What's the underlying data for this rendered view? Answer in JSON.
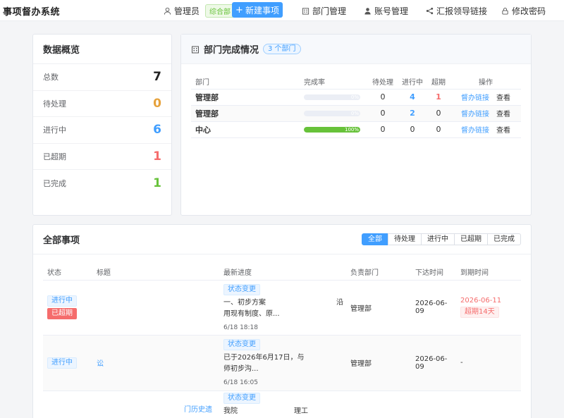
{
  "header": {
    "brand": "事项督办系统",
    "user": "管理员",
    "role": "综合部",
    "new_task": "新建事项",
    "nav": [
      "部门管理",
      "账号管理",
      "汇报领导链接",
      "修改密码"
    ]
  },
  "overview": {
    "title": "数据概览",
    "items": [
      {
        "label": "总数",
        "value": "7",
        "color": "#222222"
      },
      {
        "label": "待处理",
        "value": "0",
        "color": "#e6a23c"
      },
      {
        "label": "进行中",
        "value": "6",
        "color": "#409eff"
      },
      {
        "label": "已超期",
        "value": "1",
        "color": "#f56c6c"
      },
      {
        "label": "已完成",
        "value": "1",
        "color": "#67c23a"
      }
    ]
  },
  "dept": {
    "title": "部门完成情况",
    "badge": "3 个部门",
    "columns": [
      "部门",
      "完成率",
      "待处理",
      "进行中",
      "超期",
      "操作"
    ],
    "rows": [
      {
        "name": "管理部",
        "rate": 0,
        "rate_label": "0%",
        "pending": "0",
        "ongoing": "4",
        "overdue": "1",
        "link": "督办链接",
        "view": "查看"
      },
      {
        "name": "管理部",
        "rate": 0,
        "rate_label": "0%",
        "pending": "0",
        "ongoing": "2",
        "overdue": "0",
        "link": "督办链接",
        "view": "查看"
      },
      {
        "name": "中心",
        "rate": 100,
        "rate_label": "100%",
        "pending": "0",
        "ongoing": "0",
        "overdue": "0",
        "link": "督办链接",
        "view": "查看"
      }
    ]
  },
  "tasks": {
    "title": "全部事项",
    "filters": [
      "全部",
      "待处理",
      "进行中",
      "已超期",
      "已完成"
    ],
    "active_filter": "全部",
    "columns": [
      "状态",
      "标题",
      "最新进度",
      "负责部门",
      "下达时间",
      "到期时间"
    ],
    "rows": [
      {
        "status": "进行中",
        "overdue_tag": "已超期",
        "title": "",
        "progress_tag": "状态变更",
        "progress": "一、初步方案　　　　　　　　　　沿用现有制度、原...",
        "progress_time": "6/18 18:18",
        "dept": "管理部",
        "issued": "2026-06-09",
        "due": "2026-06-11",
        "due_note": "超期14天"
      },
      {
        "status": "进行中",
        "overdue_tag": "",
        "title": "讼",
        "progress_tag": "状态变更",
        "progress": "已于2026年6月17日，与　　　　　　　师初步沟...",
        "progress_time": "6/18 16:05",
        "dept": "管理部",
        "issued": "2026-06-09",
        "due": "-",
        "due_note": ""
      },
      {
        "status": "",
        "overdue_tag": "",
        "title": "门历史遗",
        "progress_tag": "状态变更",
        "progress": "我院　　　　　　　　理工",
        "progress_time": "",
        "dept": "",
        "issued": "",
        "due": "",
        "due_note": ""
      }
    ]
  }
}
